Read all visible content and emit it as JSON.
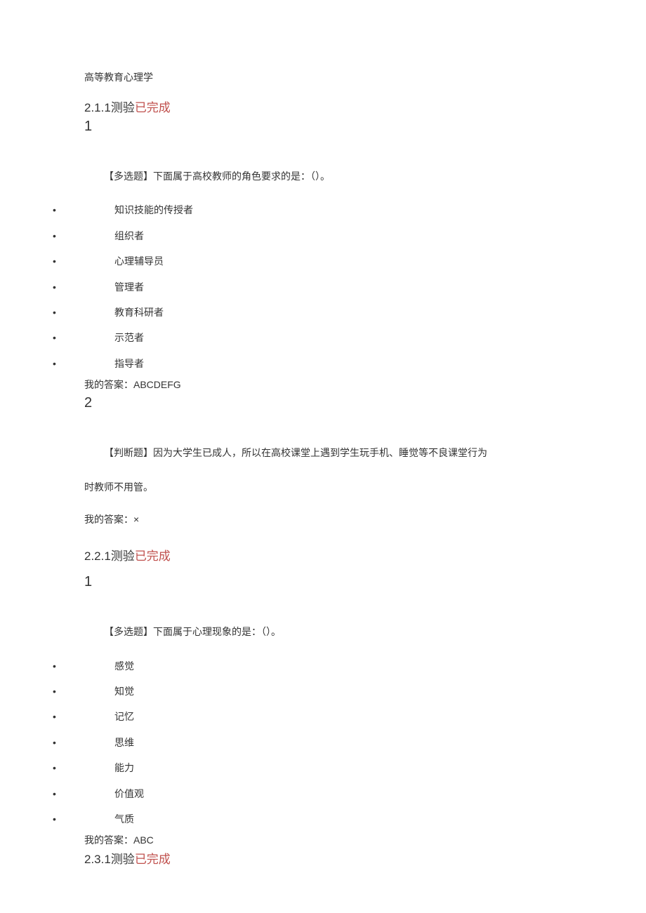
{
  "page_title": "高等教育心理学",
  "sections": [
    {
      "heading_number": "2.1.1",
      "heading_word": "测验",
      "status": "已完成",
      "questions": [
        {
          "number": "1",
          "type_label": "【多选题】",
          "stem": "下面属于高校教师的角色要求的是：（）。",
          "options": [
            "知识技能的传授者",
            "组织者",
            "心理辅导员",
            "管理者",
            "教育科研者",
            "示范者",
            "指导者"
          ],
          "answer_label": "我的答案：",
          "answer_value": "ABCDEFG"
        },
        {
          "number": "2",
          "type_label": "【判断题】",
          "stem_line1": "因为大学生已成人，所以在高校课堂上遇到学生玩手机、睡觉等不良课堂行为",
          "stem_line2": "时教师不用管。",
          "answer_label": "我的答案：",
          "answer_value": "×"
        }
      ]
    },
    {
      "heading_number": "2.2.1",
      "heading_word": "测验",
      "status": "已完成",
      "questions": [
        {
          "number": "1",
          "type_label": "【多选题】",
          "stem": "下面属于心理现象的是：（）。",
          "options": [
            "感觉",
            "知觉",
            "记忆",
            "思维",
            "能力",
            "价值观",
            "气质"
          ],
          "answer_label": "我的答案：",
          "answer_value": "ABC"
        }
      ]
    },
    {
      "heading_number": "2.3.1",
      "heading_word": "测验",
      "status": "已完成"
    }
  ]
}
